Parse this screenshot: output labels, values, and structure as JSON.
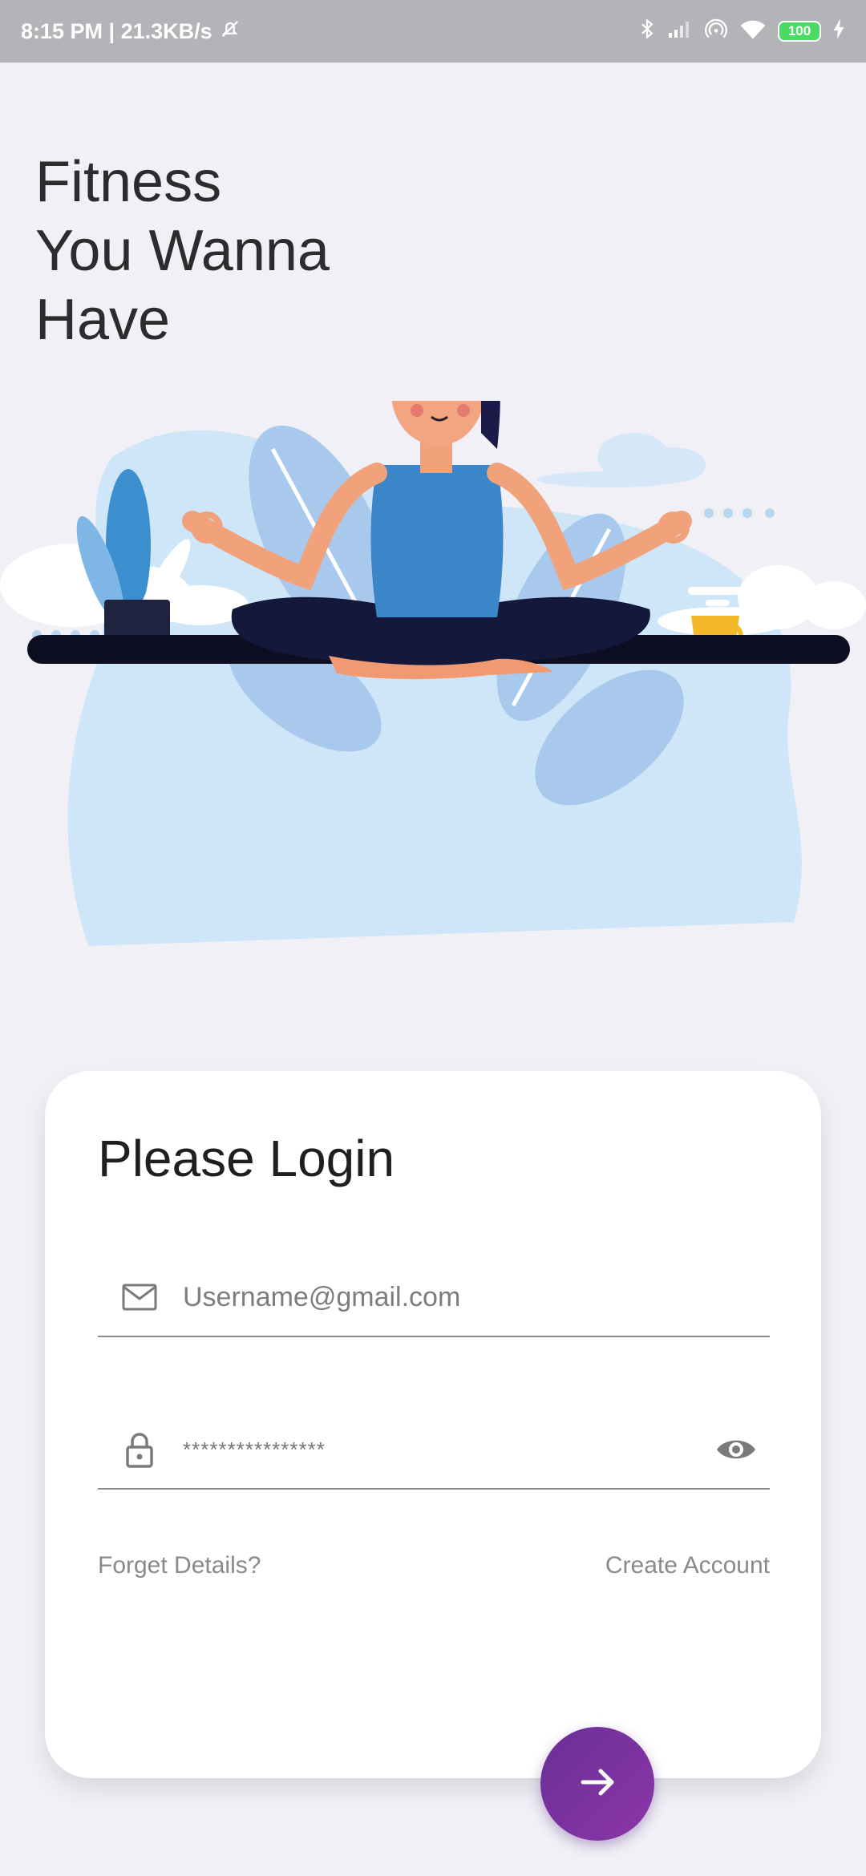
{
  "status_bar": {
    "time_speed": "8:15 PM | 21.3KB/s",
    "battery": "100",
    "icons": [
      "mute-icon",
      "bluetooth-icon",
      "signal-icon",
      "hotspot-icon",
      "wifi-icon",
      "battery-icon",
      "charging-icon"
    ]
  },
  "headline": {
    "line1": "Fitness",
    "line2": "You Wanna",
    "line3": "Have"
  },
  "illustration": {
    "subject": "woman-meditating-yoga-illustration"
  },
  "login": {
    "title": "Please Login",
    "username_placeholder": "Username@gmail.com",
    "username_value": "",
    "password_value": "****************",
    "forget_label": "Forget Details?",
    "create_label": "Create Account"
  },
  "colors": {
    "background": "#f0f0f6",
    "accent_start": "#6a2f98",
    "accent_end": "#8b36a6",
    "status_bar": "#b3b4b8"
  }
}
